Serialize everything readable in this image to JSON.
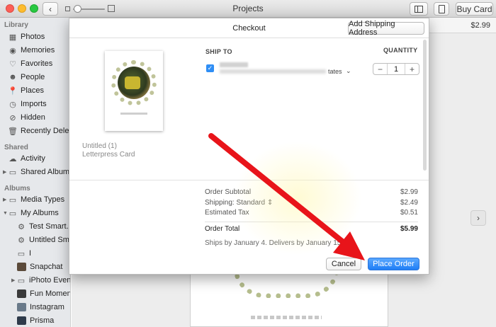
{
  "window": {
    "title": "Projects",
    "buy_card_label": "Buy Card",
    "price_display": "$2.99"
  },
  "sidebar": {
    "sections": {
      "library": "Library",
      "shared": "Shared",
      "albums": "Albums"
    },
    "library_items": [
      "Photos",
      "Memories",
      "Favorites",
      "People",
      "Places",
      "Imports",
      "Hidden",
      "Recently Delet..."
    ],
    "shared_items": [
      "Activity",
      "Shared Albums"
    ],
    "album_items": [
      "Media Types",
      "My Albums",
      "Test Smart...",
      "Untitled Sm...",
      "I",
      "Snapchat",
      "iPhoto Events",
      "Fun Moments",
      "Instagram",
      "Prisma"
    ]
  },
  "checkout": {
    "title": "Checkout",
    "add_shipping_label": "Add Shipping Address",
    "item_name": "Untitled (1)",
    "item_type": "Letterpress Card",
    "ship_to_label": "SHIP TO",
    "quantity_label": "QUANTITY",
    "address_tail": "tates",
    "quantity": "1",
    "summary": {
      "subtotal_label": "Order Subtotal",
      "subtotal": "$2.99",
      "shipping_label": "Shipping: Standard",
      "shipping": "$2.49",
      "tax_label": "Estimated Tax",
      "tax": "$0.51",
      "total_label": "Order Total",
      "total": "$5.99"
    },
    "ships_by": "Ships by January 4. Delivers by January 15.",
    "cancel_label": "Cancel",
    "place_order_label": "Place Order"
  },
  "colors": {
    "accent": "#1f7ef6",
    "annotation_arrow": "#e8141a"
  }
}
